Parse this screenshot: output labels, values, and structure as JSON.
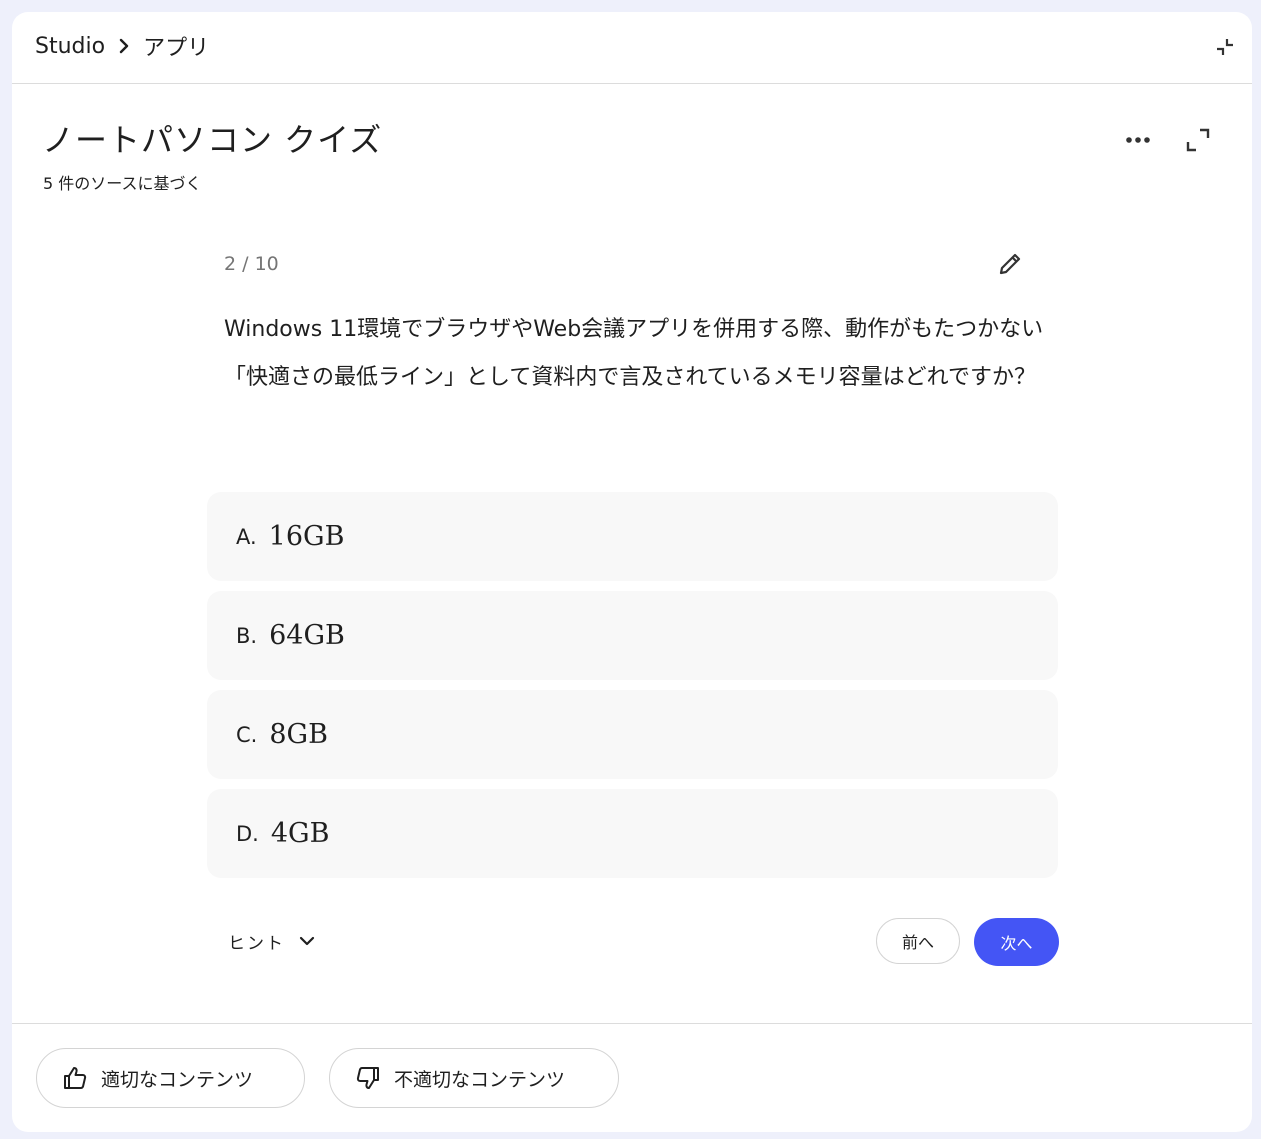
{
  "breadcrumb": {
    "root": "Studio",
    "current": "アプリ"
  },
  "quiz": {
    "title": "ノートパソコン クイズ",
    "subtitle": "5 件のソースに基づく",
    "progress": "2 / 10",
    "question": "Windows 11環境でブラウザやWeb会議アプリを併用する際、動作がもたつかない「快適さの最低ライン」として資料内で言及されているメモリ容量はどれですか？",
    "options": [
      {
        "letter": "A.",
        "text": "16GB"
      },
      {
        "letter": "B.",
        "text": "64GB"
      },
      {
        "letter": "C.",
        "text": "8GB"
      },
      {
        "letter": "D.",
        "text": "4GB"
      }
    ],
    "hint_label": "ヒント",
    "prev_label": "前へ",
    "next_label": "次へ"
  },
  "feedback": {
    "good_label": "適切なコンテンツ",
    "bad_label": "不適切なコンテンツ"
  },
  "colors": {
    "accent": "#4455f5",
    "background": "#eef0fb",
    "option_bg": "#f8f8f8"
  }
}
